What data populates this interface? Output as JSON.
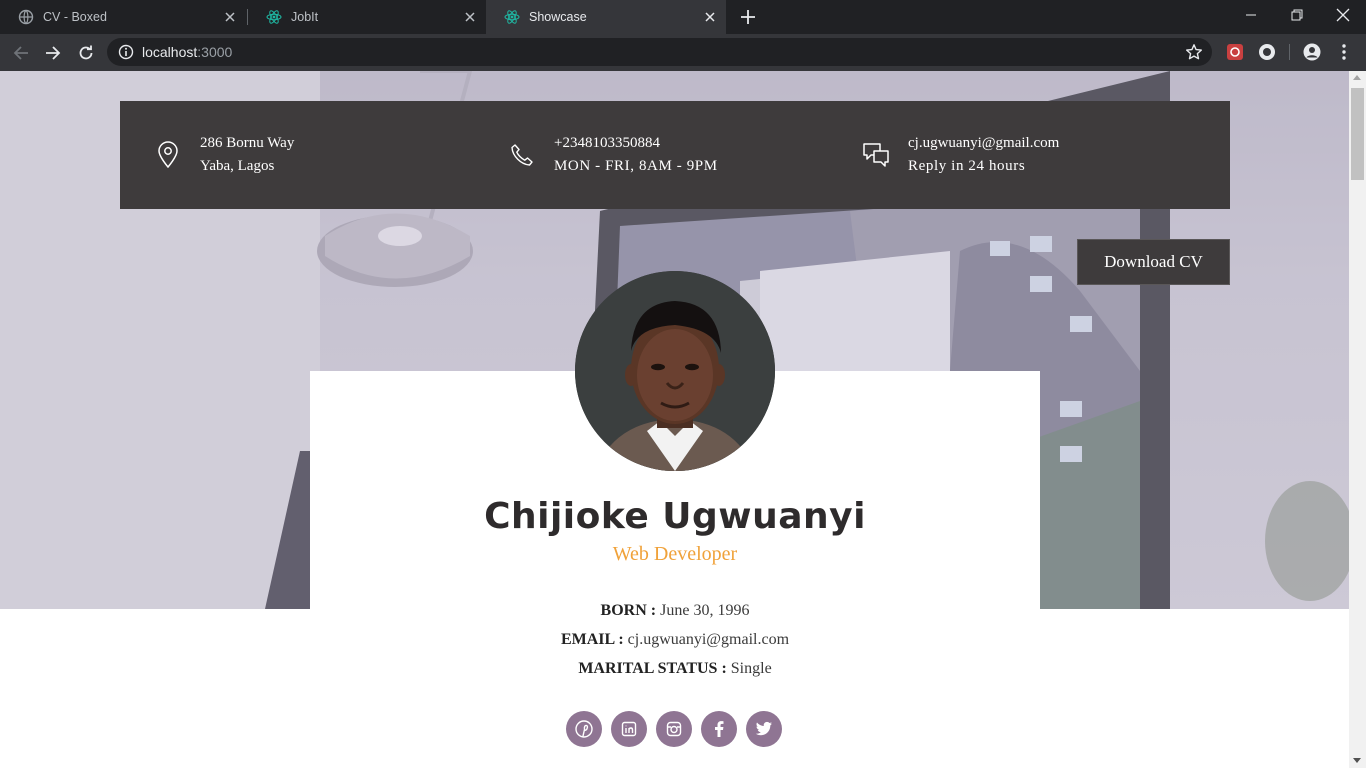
{
  "browser": {
    "tabs": [
      {
        "title": "CV - Boxed",
        "icon": "globe-icon"
      },
      {
        "title": "JobIt",
        "icon": "react-icon"
      },
      {
        "title": "Showcase",
        "icon": "react-icon",
        "active": true
      }
    ],
    "url_host": "localhost",
    "url_port": ":3000"
  },
  "contact": {
    "address_line1": "286 Bornu Way",
    "address_line2": "Yaba, Lagos",
    "phone": "+2348103350884",
    "hours": "MON - FRI, 8AM - 9PM",
    "email": "cj.ugwuanyi@gmail.com",
    "reply": "Reply in 24 hours"
  },
  "download_label": "Download CV",
  "profile": {
    "name": "Chijioke Ugwuanyi",
    "role": "Web Developer",
    "born_label": "BORN :",
    "born": "June 30, 1996",
    "email_label": "EMAIL :",
    "email": "cj.ugwuanyi@gmail.com",
    "marital_label": "MARITAL STATUS :",
    "marital": "Single"
  },
  "socials": [
    "pinterest-icon",
    "linkedin-icon",
    "instagram-icon",
    "facebook-icon",
    "twitter-icon"
  ],
  "colors": {
    "accent": "#f0a23a",
    "dark_panel": "#3e3b3c",
    "social_bg": "#8f7593",
    "chrome_tabbar": "#202124",
    "chrome_toolbar": "#35363a"
  }
}
